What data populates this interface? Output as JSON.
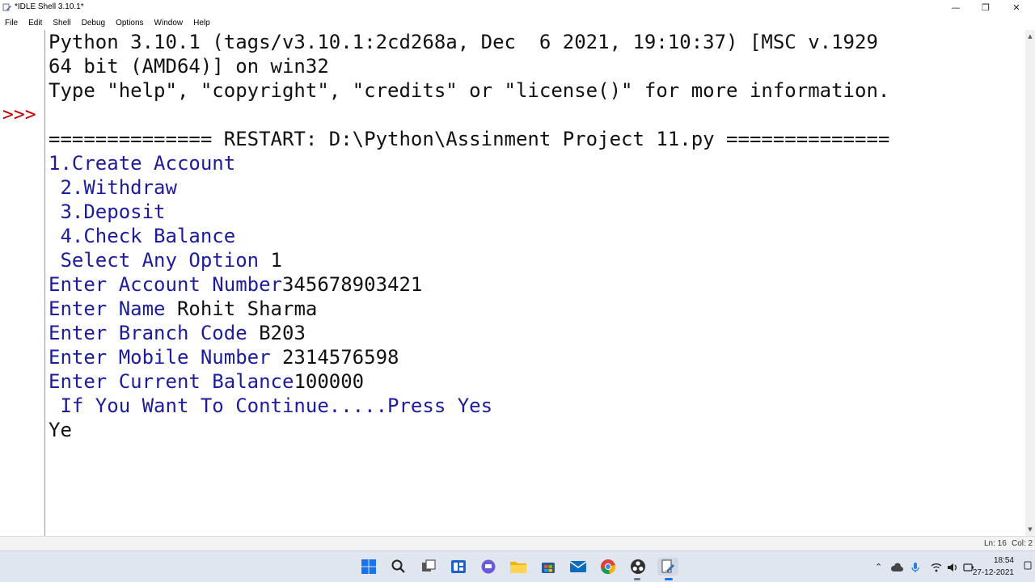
{
  "window": {
    "title": "*IDLE Shell 3.10.1*",
    "controls": {
      "minimize": "—",
      "maximize": "❐",
      "close": "✕"
    }
  },
  "menu": [
    "File",
    "Edit",
    "Shell",
    "Debug",
    "Options",
    "Window",
    "Help"
  ],
  "shell": {
    "prompt": ">>>",
    "banner": [
      "Python 3.10.1 (tags/v3.10.1:2cd268a, Dec  6 2021, 19:10:37) [MSC v.1929",
      "64 bit (AMD64)] on win32",
      "Type \"help\", \"copyright\", \"credits\" or \"license()\" for more information."
    ],
    "restart_line": "============== RESTART: D:\\Python\\Assinment Project 11.py ==============",
    "output": [
      {
        "prompt": "1.Create Account",
        "input": ""
      },
      {
        "prompt": " 2.Withdraw",
        "input": ""
      },
      {
        "prompt": " 3.Deposit",
        "input": ""
      },
      {
        "prompt": " 4.Check Balance",
        "input": ""
      },
      {
        "prompt": " Select Any Option ",
        "input": "1"
      },
      {
        "prompt": "Enter Account Number",
        "input": "345678903421"
      },
      {
        "prompt": "Enter Name ",
        "input": "Rohit Sharma"
      },
      {
        "prompt": "Enter Branch Code ",
        "input": "B203"
      },
      {
        "prompt": "Enter Mobile Number ",
        "input": "2314576598"
      },
      {
        "prompt": "Enter Current Balance",
        "input": "100000"
      },
      {
        "prompt": " If You Want To Continue.....Press Yes",
        "input": ""
      },
      {
        "prompt": "",
        "input": "Ye"
      }
    ]
  },
  "status": {
    "line": "Ln: 16",
    "col": "Col: 2"
  },
  "taskbar": {
    "icons": [
      "windows-start-icon",
      "search-icon",
      "task-view-icon",
      "widgets-icon",
      "chat-icon",
      "file-explorer-icon",
      "store-icon",
      "mail-icon",
      "chrome-icon",
      "obs-icon",
      "idle-icon"
    ],
    "time": "18:54",
    "date": "27-12-2021"
  },
  "colors": {
    "prompt_red": "#c00000",
    "stdout_blue": "#1c1c9c",
    "text_black": "#111111"
  }
}
